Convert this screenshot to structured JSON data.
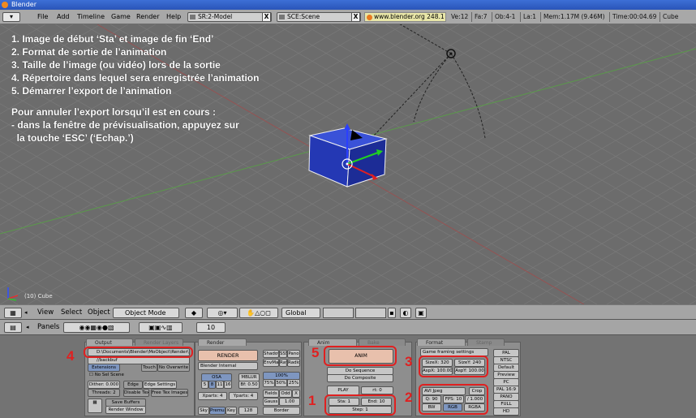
{
  "window": {
    "title": "Blender"
  },
  "top_header": {
    "menus": [
      "File",
      "Add",
      "Timeline",
      "Game",
      "Render",
      "Help"
    ],
    "screen_field": "SR:2-Model",
    "scene_field": "SCE:Scene",
    "url": "www.blender.org 248.1",
    "stats": [
      "Ve:12",
      "Fa:7",
      "Ob:4-1",
      "La:1",
      "Mem:1.17M (9.46M)",
      "Time:00:04.69",
      "Cube"
    ]
  },
  "instructions": {
    "items": [
      "1. Image de début ‘Sta’ et image de fin ‘End’",
      "2. Format de sortie de l’animation",
      "3. Taille de l’image (ou vidéo) lors de la sortie",
      "4. Répertoire dans lequel sera enregistrée l’animation",
      "5. Démarrer l’export de l’animation"
    ],
    "cancel_title": "Pour annuler l’export lorsqu’il est en cours :",
    "cancel_line1": "- dans la fenêtre de prévisualisation, appuyez sur",
    "cancel_line2": "  la touche ‘ESC’ (‘Echap.’)"
  },
  "viewport": {
    "object_label": "(10) Cube"
  },
  "view3d_header": {
    "menus": [
      "View",
      "Select",
      "Object"
    ],
    "mode": "Object Mode",
    "pivot": "Global"
  },
  "panels_header": {
    "label": "Panels",
    "frame": "10"
  },
  "output_panel": {
    "tab": "Output",
    "tab2": "Render Layers",
    "path": "D:\\Documents\\Blender\\MoObject\\Render\\",
    "backbuf": "//backbuf",
    "extensions": "Extensions",
    "touch": "Touch",
    "no_overwrite": "No Overwrite",
    "no_sel_scene": "No Sel Scene",
    "dither": "Dither: 0.000",
    "edge": "Edge",
    "edge_settings": "Edge Settings",
    "threads": "Threads: 2",
    "disable_tex": "Disable Tex",
    "free_tex_images": "Free Tex Images",
    "save_buffers": "Save Buffers",
    "render_window": "Render Window"
  },
  "render_panel": {
    "tab": "Render",
    "render_btn": "RENDER",
    "engine": "Blender Internal",
    "osa": "OSA",
    "osa_values": [
      "5",
      "8",
      "11",
      "16"
    ],
    "mblur": "MBLUR",
    "bf": "Bf: 0.50",
    "xparts": "Xparts: 4",
    "yparts": "Yparts: 4",
    "fields": "Fields",
    "odd": "Odd",
    "x": "X",
    "shadow": "Shadow",
    "ss": "SSS",
    "pano": "Pano",
    "envmap": "EnvMap",
    "ray": "Ray",
    "radio": "Radio",
    "percent_100": "100%",
    "percents": [
      "75%",
      "50%",
      "25%"
    ],
    "gauss": "Gauss",
    "gauss_val": "1.00",
    "sky": "Sky",
    "premul": "Premul",
    "key": "Key",
    "key_val": "128",
    "border": "Border"
  },
  "anim_panel": {
    "tab": "Anim",
    "tab2": "Bake",
    "anim_btn": "ANIM",
    "do_sequence": "Do Sequence",
    "do_composite": "Do Composite",
    "play": "PLAY",
    "rt": "rt: 0",
    "sta": "Sta: 1",
    "end": "End: 10",
    "step": "Step: 1"
  },
  "format_panel": {
    "tab": "Format",
    "tab2": "Stamp",
    "game_framing": "Game framing settings",
    "size_x": "SizeX: 320",
    "size_y": "SizeY: 240",
    "asp_x": "AspX: 100.00",
    "asp_y": "AspY: 100.00",
    "codec": "AVI Jpeg",
    "crop": "Crop",
    "quality": "Q: 90",
    "fps": "FPS: 10",
    "fps_div": "/ 1.000",
    "bw": "BW",
    "rgb": "RGB",
    "rgba": "RGBA",
    "presets": [
      "PAL",
      "NTSC",
      "Default",
      "Preview",
      "PC",
      "PAL 16:9",
      "PANO",
      "FULL",
      "HD"
    ]
  },
  "callouts": [
    "1",
    "2",
    "3",
    "4",
    "5"
  ],
  "colors": {
    "highlight": "#e02020",
    "cube": "#2a3fbf",
    "viewport_bg": "#6c6c6c"
  }
}
